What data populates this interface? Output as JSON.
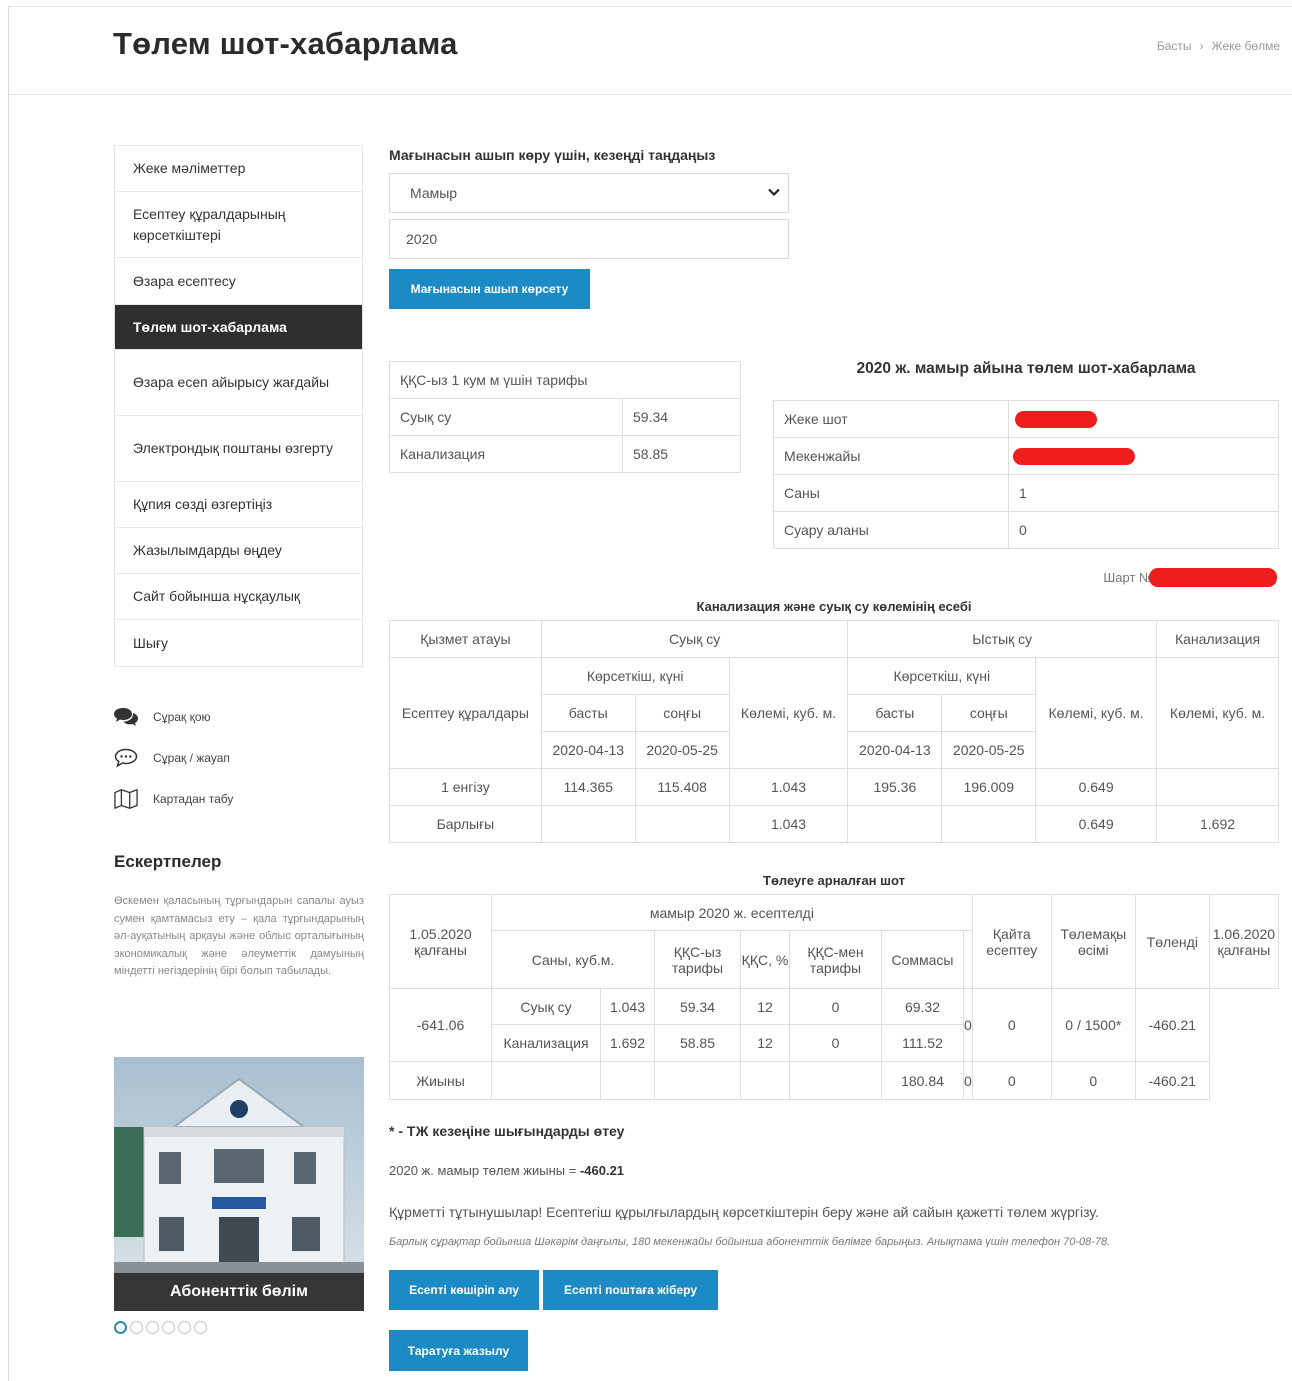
{
  "header": {
    "title": "Төлем шот-хабарлама",
    "breadcrumb": [
      "Басты",
      "Жеке бөлме"
    ]
  },
  "sidebar": {
    "items": [
      {
        "label": "Жеке мәліметтер",
        "active": false
      },
      {
        "label": "Есептеу құралдарының көрсеткіштері",
        "active": false
      },
      {
        "label": "Өзара есептесу",
        "active": false
      },
      {
        "label": "Төлем шот-хабарлама",
        "active": true
      },
      {
        "label": "Өзара есеп айырысу жағдайы",
        "active": false
      },
      {
        "label": "Электрондық поштаны өзгерту",
        "active": false
      },
      {
        "label": "Құпия сөзді өзгертіңіз",
        "active": false
      },
      {
        "label": "Жазылымдарды өңдеу",
        "active": false
      },
      {
        "label": "Сайт бойынша нұсқаулық",
        "active": false
      },
      {
        "label": "Шығу",
        "active": false
      }
    ],
    "links": [
      {
        "label": "Сұрақ қою",
        "icon": "chat-bubbles-icon"
      },
      {
        "label": "Сұрақ / жауап",
        "icon": "speech-bubble-icon"
      },
      {
        "label": "Картадан табу",
        "icon": "map-icon"
      }
    ],
    "notes_title": "Ескертпелер",
    "notes_text": "Өскемен қаласының тұрғындарын сапалы ауыз сумен қамтамасыз ету – қала тұрғындарының әл-ауқатының арқауы және облыс орталығының экономикалық және әлеуметтік дамуының міндетті негіздерінің бірі болып табылады.",
    "photo_caption": "Абоненттік бөлім",
    "carousel_count": 6,
    "carousel_active": 0
  },
  "period": {
    "label": "Мағынасын ашып көру үшін, кезеңді таңдаңыз",
    "month": "Мамыр",
    "year": "2020",
    "show_button": "Мағынасын ашып көрсету"
  },
  "tariff": {
    "header": "ҚҚС-ыз 1 кум м үшін тарифы",
    "rows": [
      {
        "name": "Суық су",
        "value": "59.34"
      },
      {
        "name": "Канализация",
        "value": "58.85"
      }
    ]
  },
  "bill": {
    "title": "2020 ж. мамыр айына төлем шот-хабарлама",
    "rows": [
      {
        "label": "Жеке шот",
        "value": "",
        "redacted": true
      },
      {
        "label": "Мекенжайы",
        "value": "",
        "redacted": true
      },
      {
        "label": "Саны",
        "value": "1",
        "redacted": false
      },
      {
        "label": "Суару аланы",
        "value": "0",
        "redacted": false
      }
    ],
    "shart_label": "Шарт №"
  },
  "volume": {
    "title": "Канализация және суық су көлемінің есебі",
    "h_service": "Қызмет атауы",
    "h_cold": "Суық су",
    "h_hot": "Ыстық су",
    "h_sewer": "Канализация",
    "h_reading_day": "Көрсеткіш, күні",
    "h_devices": "Есептеу құралдары",
    "h_first": "басты",
    "h_last": "соңғы",
    "h_volume": "Көлемі, куб. м.",
    "date_first": "2020-04-13",
    "date_last": "2020-05-25",
    "rows": [
      {
        "name": "1 енгізу",
        "cold_first": "114.365",
        "cold_last": "115.408",
        "cold_vol": "1.043",
        "hot_first": "195.36",
        "hot_last": "196.009",
        "hot_vol": "0.649",
        "sewer_vol": ""
      },
      {
        "name": "Барлығы",
        "cold_first": "",
        "cold_last": "",
        "cold_vol": "1.043",
        "hot_first": "",
        "hot_last": "",
        "hot_vol": "0.649",
        "sewer_vol": "1.692"
      }
    ]
  },
  "payment": {
    "title": "Төлеуге арналған шот",
    "h_left_start": "1.05.2020 қалғаны",
    "h_accrued": "мамыр 2020 ж. есептелді",
    "h_qty": "Саны, куб.м.",
    "h_tariff_novat": "ҚҚС-ыз тарифы",
    "h_vat": "ҚҚС, %",
    "h_tariff_vat": "ҚҚС-мен тарифы",
    "h_sum": "Соммасы",
    "h_recalc": "Қайта есептеу",
    "h_fee": "Төлемақы өсімі",
    "h_paid": "Төленді",
    "h_left_end": "1.06.2020 қалғаны",
    "start_balance": "-641.06",
    "recalc": "0",
    "fee": "0",
    "paid": "0 / 1500*",
    "end_balance": "-460.21",
    "rows": [
      {
        "service": "Суық су",
        "qty": "1.043",
        "tariff": "59.34",
        "vat": "12",
        "tariff_vat": "0",
        "sum": "69.32"
      },
      {
        "service": "Канализация",
        "qty": "1.692",
        "tariff": "58.85",
        "vat": "12",
        "tariff_vat": "0",
        "sum": "111.52"
      }
    ],
    "total": {
      "label": "Жиыны",
      "sum": "180.84",
      "recalc": "0",
      "fee": "0",
      "paid": "0",
      "end": "-460.21"
    }
  },
  "footer": {
    "note_title": "* - ТЖ кезеңіне шығындарды өтеу",
    "total_prefix": "2020 ж. мамыр төлем жиыны = ",
    "total_value": "-460.21",
    "appeal": "Құрметті тұтынушылар! Есептегіш құрылғылардың көрсеткіштерін беру және ай сайын қажетті төлем жүргізу.",
    "contact": "Барлық сұрақтар бойынша Шәкәрім даңғылы, 180 мекенжайы бойынша абоненттік бөлімге барыңыз. Анықтама үшін телефон 70-08-78.",
    "download_button": "Есепті көшіріп алу",
    "email_button": "Есепті поштаға жіберу",
    "subscribe_button": "Таратуға жазылу"
  },
  "colors": {
    "accent": "#1c8bc5",
    "active_menu": "#2f2f2f",
    "redaction": "#ee1e1e"
  }
}
